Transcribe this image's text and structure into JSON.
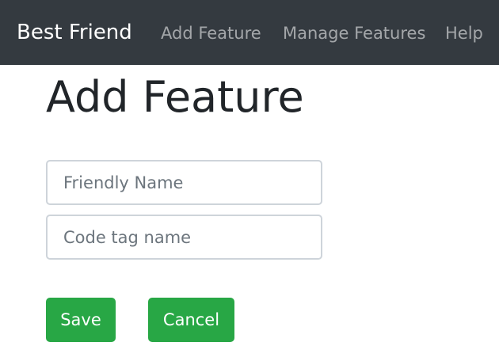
{
  "navbar": {
    "brand": "Best Friend",
    "links": [
      {
        "label": "Add Feature"
      },
      {
        "label": "Manage Features"
      },
      {
        "label": "Help"
      }
    ]
  },
  "main": {
    "title": "Add Feature",
    "fields": {
      "friendly_name": {
        "value": "",
        "placeholder": "Friendly Name"
      },
      "code_tag_name": {
        "value": "",
        "placeholder": "Code tag name"
      }
    },
    "buttons": {
      "save_label": "Save",
      "cancel_label": "Cancel"
    }
  },
  "colors": {
    "navbar_bg": "#343a40",
    "button_green": "#28a745",
    "input_border": "#ced4da"
  }
}
